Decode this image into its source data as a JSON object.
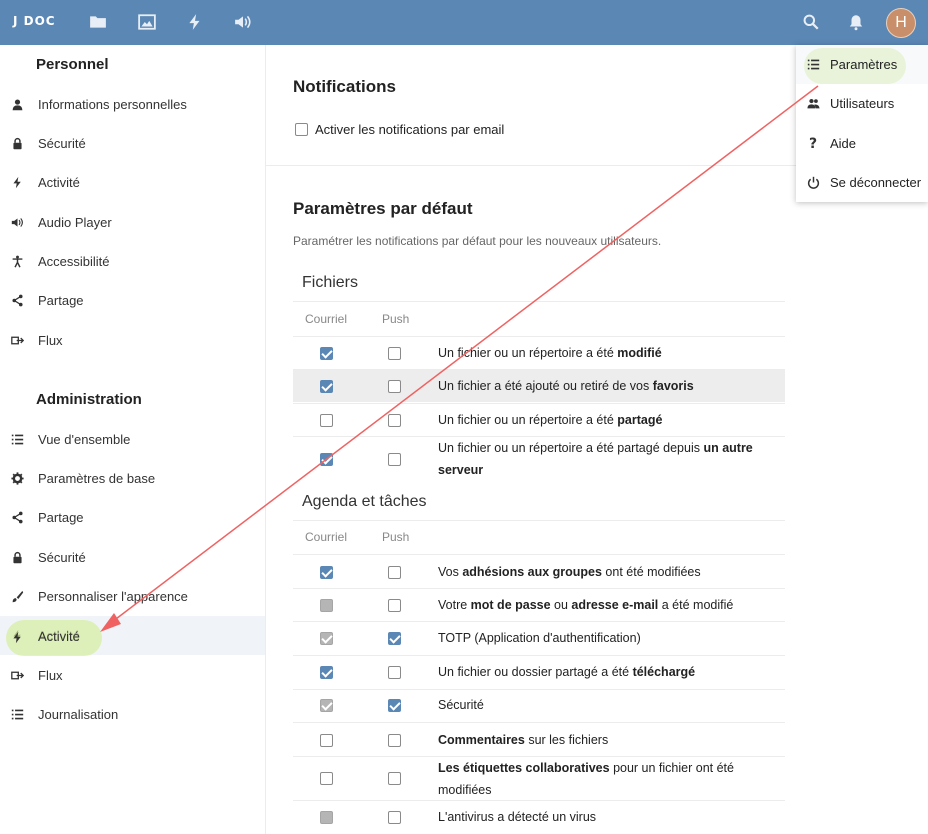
{
  "header": {
    "logo": "J DOC",
    "avatar_letter": "H",
    "icons": [
      "files-icon",
      "gallery-icon",
      "activity-icon",
      "audio-icon",
      "search-icon",
      "notifications-icon"
    ]
  },
  "sidebar": {
    "personal_title": "Personnel",
    "personal_items": [
      {
        "label": "Informations personnelles",
        "icon": "person-icon"
      },
      {
        "label": "Sécurité",
        "icon": "lock-icon"
      },
      {
        "label": "Activité",
        "icon": "activity-icon"
      },
      {
        "label": "Audio Player",
        "icon": "audio-icon"
      },
      {
        "label": "Accessibilité",
        "icon": "accessibility-icon"
      },
      {
        "label": "Partage",
        "icon": "share-icon"
      },
      {
        "label": "Flux",
        "icon": "flux-icon"
      }
    ],
    "admin_title": "Administration",
    "admin_items": [
      {
        "label": "Vue d'ensemble",
        "icon": "list-icon"
      },
      {
        "label": "Paramètres de base",
        "icon": "gear-icon"
      },
      {
        "label": "Partage",
        "icon": "share-icon"
      },
      {
        "label": "Sécurité",
        "icon": "lock-icon"
      },
      {
        "label": "Personnaliser l'apparence",
        "icon": "brush-icon"
      },
      {
        "label": "Activité",
        "icon": "activity-icon",
        "active": true
      },
      {
        "label": "Flux",
        "icon": "flux-icon"
      },
      {
        "label": "Journalisation",
        "icon": "list-icon"
      }
    ]
  },
  "notifications": {
    "title": "Notifications",
    "email_label": "Activer les notifications par email"
  },
  "defaults": {
    "title": "Paramètres par défaut",
    "subtitle": "Paramétrer les notifications par défaut pour les nouveaux utilisateurs.",
    "col_mail": "Courriel",
    "col_push": "Push",
    "groups": [
      {
        "title": "Fichiers",
        "rows": [
          {
            "text": "Un fichier ou un répertoire a été <b>modifié</b>",
            "mail": "checked",
            "push": "off"
          },
          {
            "text": "Un fichier a été ajouté ou retiré de vos <b>favoris</b>",
            "mail": "checked",
            "push": "off",
            "highlight": true
          },
          {
            "text": "Un fichier ou un répertoire a été <b>partagé</b>",
            "mail": "off",
            "push": "off"
          },
          {
            "text": "Un fichier ou un répertoire a été partagé depuis <b>un autre serveur</b>",
            "mail": "checked",
            "push": "off",
            "tall": true
          }
        ]
      },
      {
        "title": "Agenda et tâches",
        "rows": [
          {
            "text": "Vos <b>adhésions aux groupes</b> ont été modifiées",
            "mail": "checked",
            "push": "off"
          },
          {
            "text": "Votre <b>mot de passe</b> ou <b>adresse e-mail</b> a été modifié",
            "mail": "grey",
            "push": "off"
          },
          {
            "text": "TOTP (Application d'authentification)",
            "mail": "greychk",
            "push": "checked"
          },
          {
            "text": "Un fichier ou dossier partagé a été <b>téléchargé</b>",
            "mail": "checked",
            "push": "off"
          },
          {
            "text": "Sécurité",
            "mail": "greychk",
            "push": "checked"
          },
          {
            "text": "<b>Commentaires</b> sur les fichiers",
            "mail": "off",
            "push": "off"
          },
          {
            "text": "<b>Les étiquettes collaboratives</b> pour un fichier ont été modifiées",
            "mail": "off",
            "push": "off",
            "tall": true
          },
          {
            "text": "L'antivirus a détecté un virus",
            "mail": "grey",
            "push": "off"
          }
        ]
      }
    ]
  },
  "menu": {
    "items": [
      {
        "label": "Paramètres",
        "icon": "settings-list-icon"
      },
      {
        "label": "Utilisateurs",
        "icon": "users-icon"
      },
      {
        "label": "Aide",
        "icon": "help-icon"
      },
      {
        "label": "Se déconnecter",
        "icon": "power-icon"
      }
    ]
  },
  "colors": {
    "header": "#5b87b5",
    "checkbox": "#5b87b5",
    "annotation_arrow": "#f06262",
    "annotation_highlight": "#d6eea0"
  }
}
